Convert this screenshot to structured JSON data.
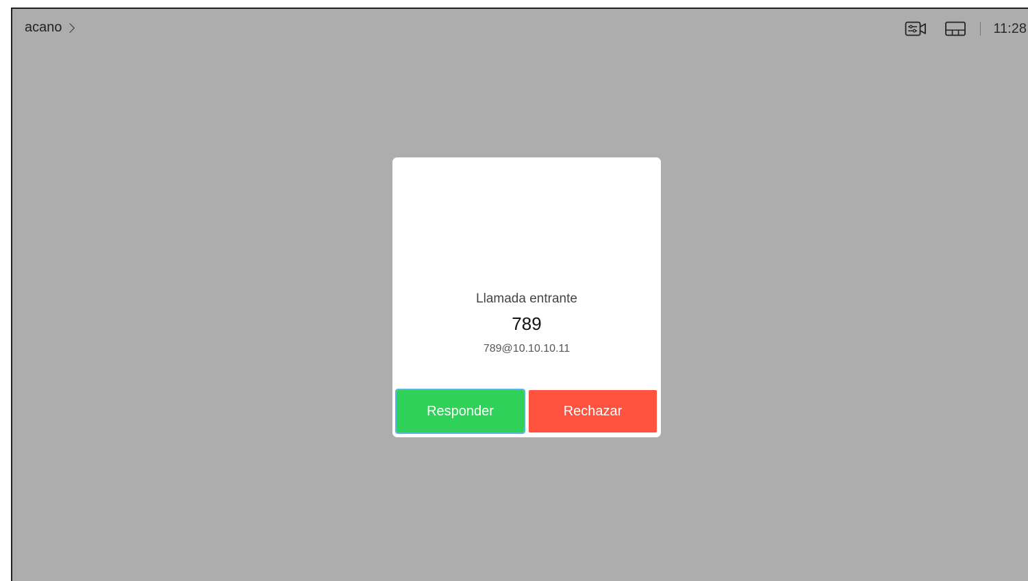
{
  "topbar": {
    "title": "acano",
    "time": "11:28",
    "icons": [
      "camera-controls-icon",
      "layout-icon"
    ]
  },
  "incoming_call": {
    "caption": "Llamada entrante",
    "caller_number": "789",
    "caller_address": "789@10.10.10.11",
    "answer_label": "Responder",
    "decline_label": "Rechazar"
  },
  "colors": {
    "background": "#adadad",
    "answer": "#2fd158",
    "decline": "#ff5340",
    "focus_ring": "#5ab4e8"
  }
}
